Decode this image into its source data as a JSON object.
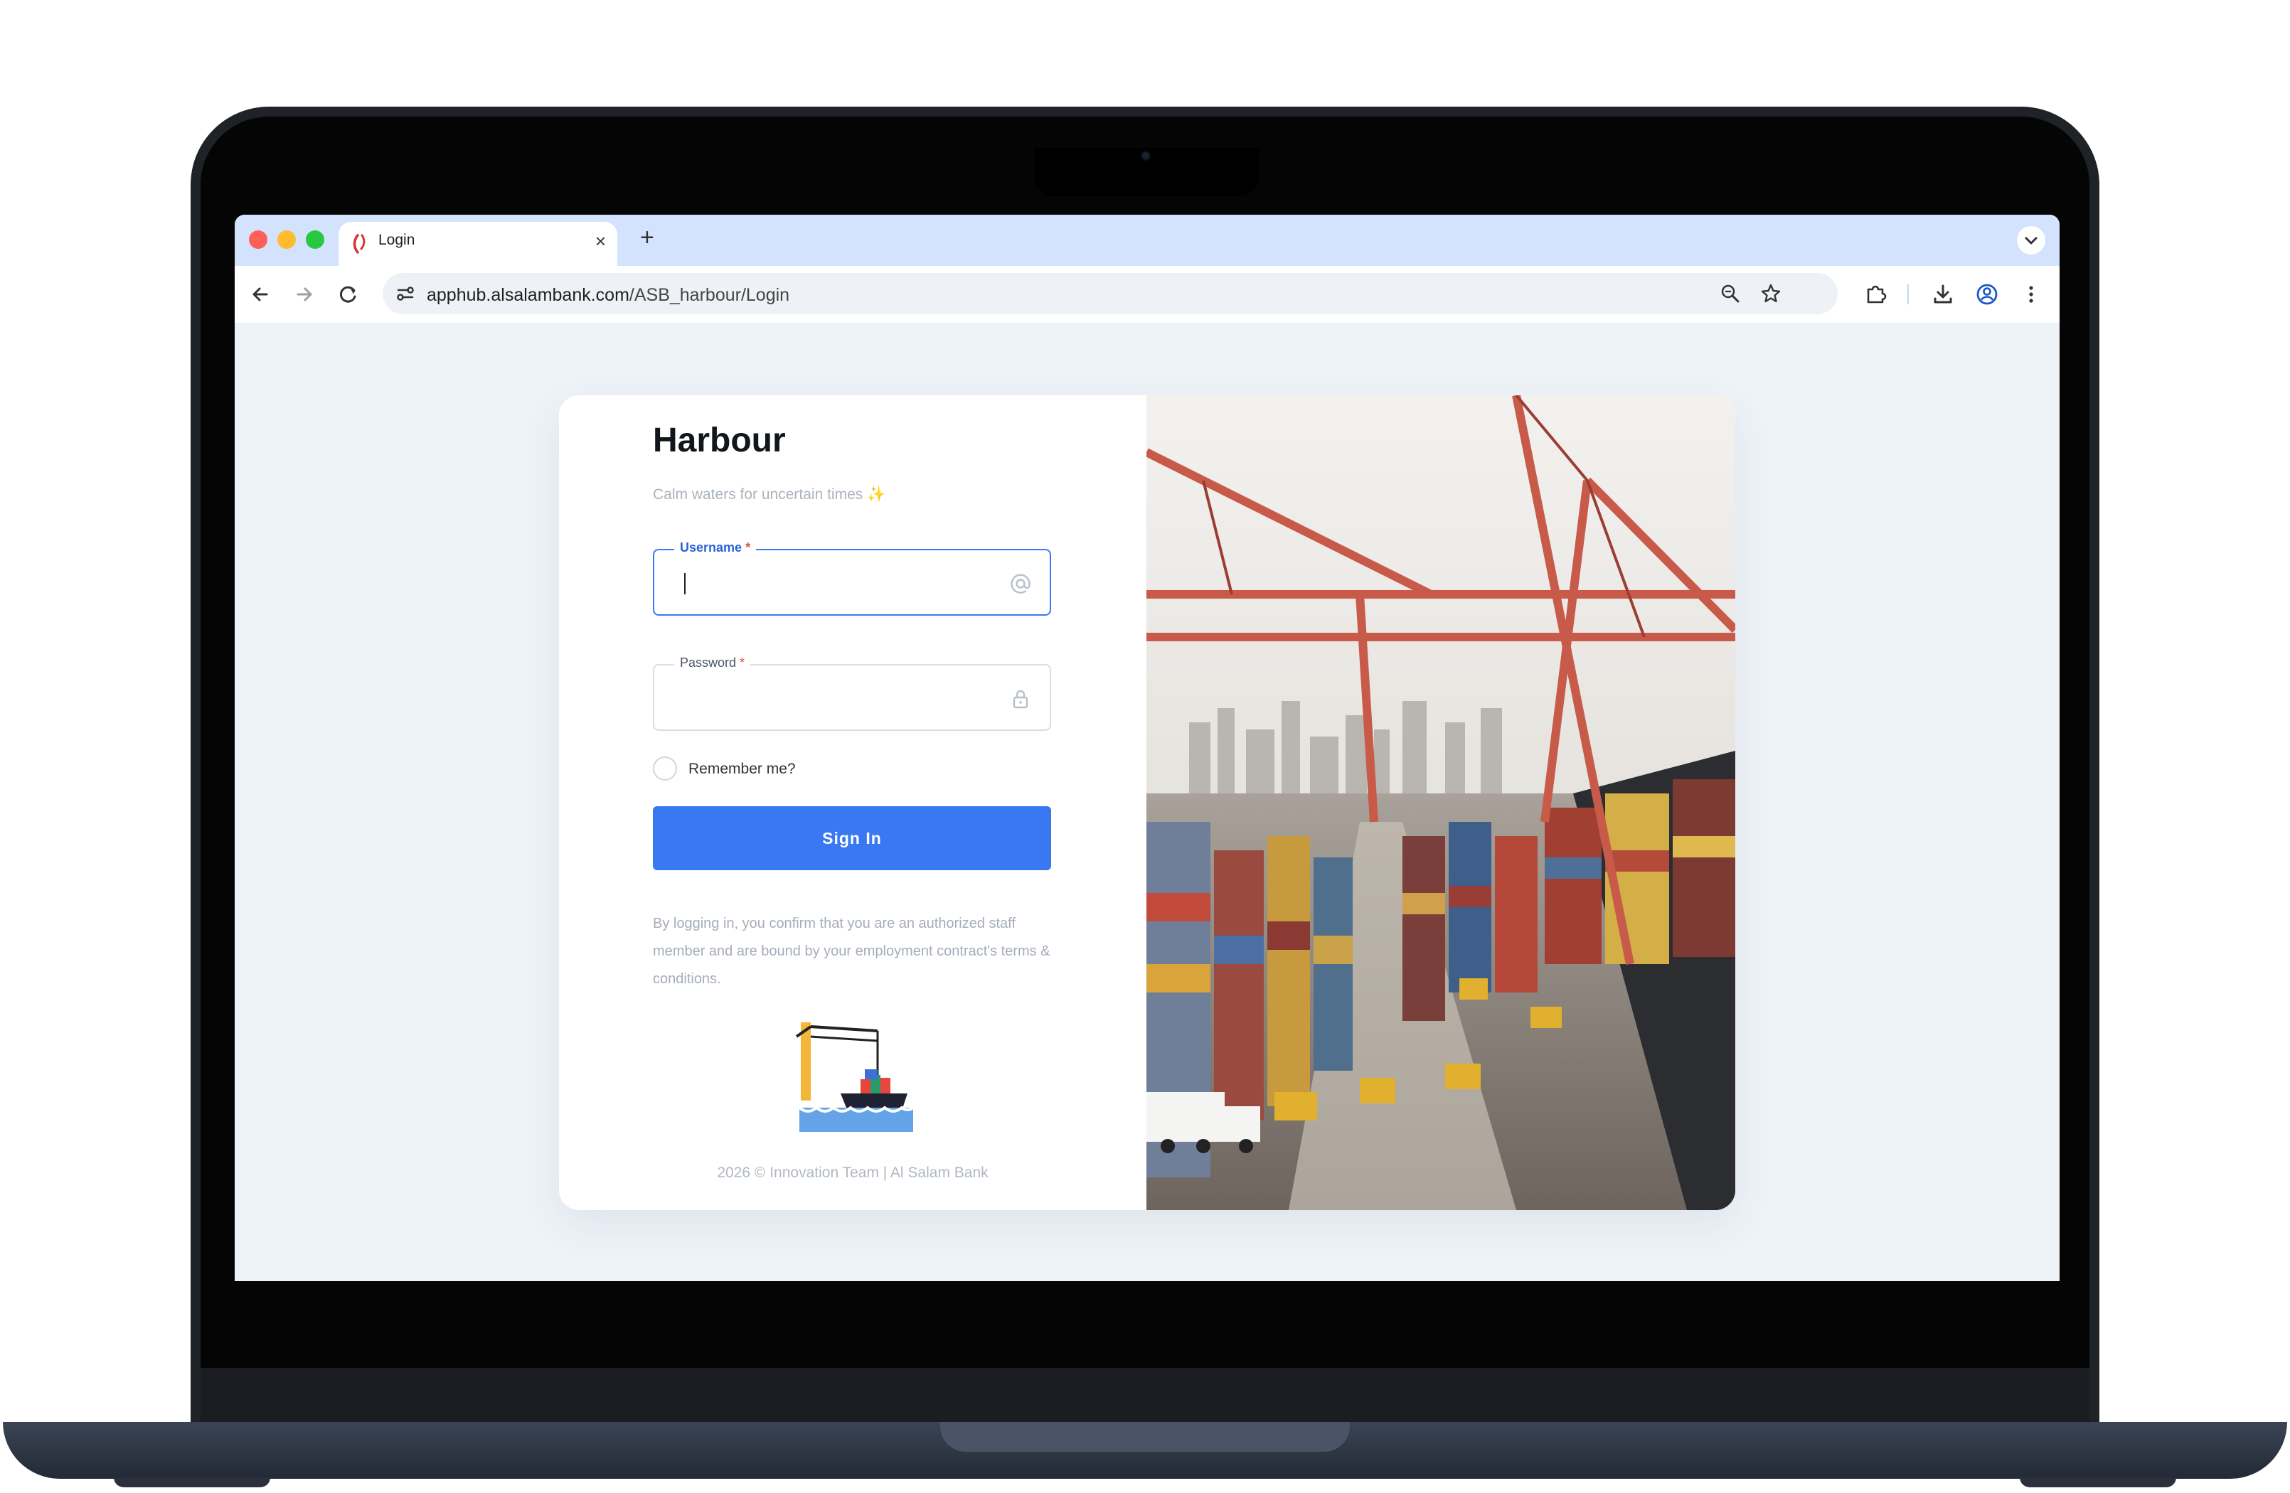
{
  "browser": {
    "tab_title": "Login",
    "tab_close": "×",
    "new_tab": "+",
    "url_host": "apphub.alsalambank.com",
    "url_path": "/ASB_harbour/Login"
  },
  "login": {
    "title": "Harbour",
    "subtitle": "Calm waters for uncertain times ✨",
    "username_label": "Username",
    "password_label": "Password",
    "required_mark": "*",
    "username_value": "",
    "password_value": "",
    "remember_label": "Remember me?",
    "signin_label": "Sign In",
    "disclaimer": "By logging in, you confirm that you are an authorized staff member and are bound by your employment contract's terms & conditions.",
    "footer": "2026 © Innovation Team | Al Salam Bank"
  },
  "icons": {
    "username_field": "at-sign-icon",
    "password_field": "lock-icon"
  },
  "colors": {
    "primary": "#3978f2",
    "required": "#e14b4b",
    "tab_strip": "#d3e3fd"
  }
}
